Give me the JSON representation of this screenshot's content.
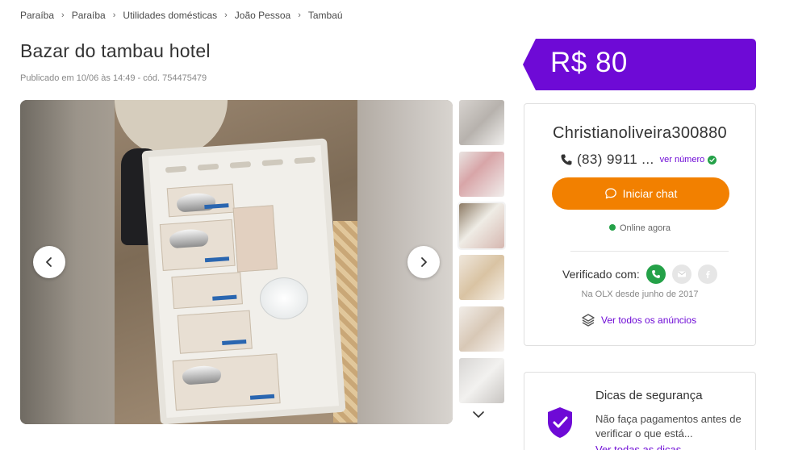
{
  "breadcrumb": {
    "items": [
      "Paraíba",
      "Paraíba",
      "Utilidades domésticas",
      "João Pessoa",
      "Tambaú"
    ],
    "separator": "›"
  },
  "ad": {
    "title": "Bazar do tambau hotel",
    "meta": "Publicado em 10/06 às 14:49 - cód. 754475479",
    "price": "R$ 80"
  },
  "gallery": {
    "prev_icon": "chevron-left-icon",
    "next_icon": "chevron-right-icon",
    "thumbnails_count": 6,
    "thumbs_more_icon": "chevron-down-icon"
  },
  "seller": {
    "name": "Christianoliveira300880",
    "phone": "(83) 9911 ...",
    "ver_numero": "ver número",
    "chat_label": "Iniciar chat",
    "online": "Online agora",
    "verified_label": "Verificado com:",
    "since": "Na OLX desde junho de 2017",
    "all_ads": "Ver todos os anúncios"
  },
  "safety": {
    "title": "Dicas de segurança",
    "body": "Não faça pagamentos antes de verificar o que está...",
    "link": "Ver todas as dicas"
  },
  "colors": {
    "purple": "#6e0ad6",
    "orange": "#f28000",
    "green": "#24a148"
  }
}
